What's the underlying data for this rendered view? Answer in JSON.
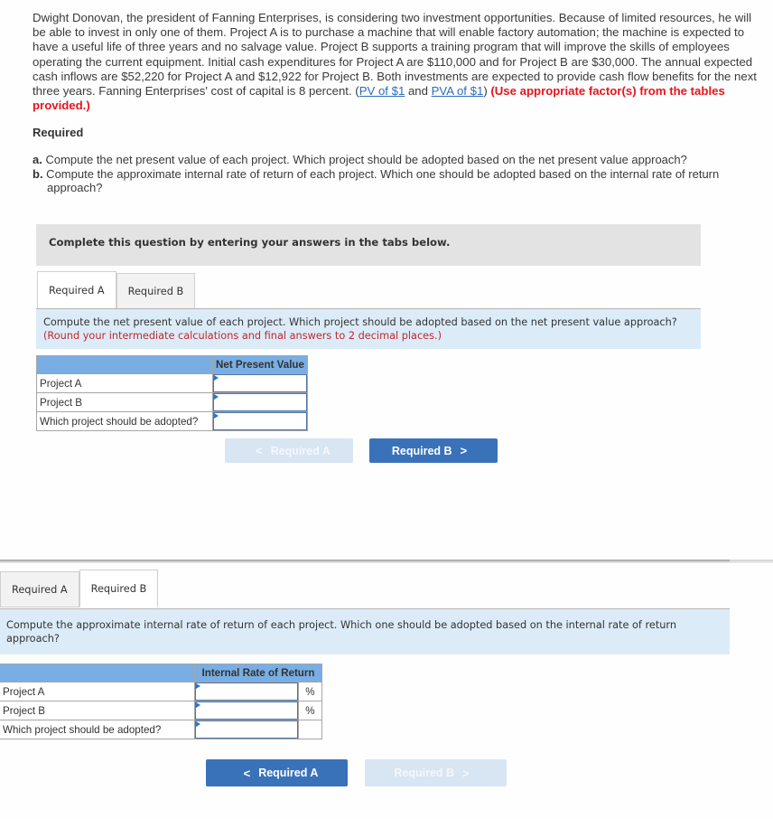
{
  "problem": {
    "text_main": "Dwight Donovan, the president of Fanning Enterprises, is considering two investment opportunities. Because of limited resources, he will be able to invest in only one of them. Project A is to purchase a machine that will enable factory automation; the machine is expected to have a useful life of three years and no salvage value. Project B supports a training program that will improve the skills of employees operating the current equipment. Initial cash expenditures for Project A are $110,000 and for Project B are $30,000. The annual expected cash inflows are $52,220 for Project A and $12,922 for Project B. Both investments are expected to provide cash flow benefits for the next three years. Fanning Enterprises' cost of capital is 8 percent. (",
    "link_pv": "PV of $1",
    "text_and": " and ",
    "link_pva": "PVA of $1",
    "text_close": ") ",
    "instruction_red": "(Use appropriate factor(s) from the tables provided.)"
  },
  "required": {
    "title": "Required",
    "items": [
      {
        "letter": "a.",
        "text": " Compute the net present value of each project. Which project should be adopted based on the net present value approach?"
      },
      {
        "letter": "b.",
        "text": " Compute the approximate internal rate of return of each project. Which one should be adopted based on the internal rate of return approach?"
      }
    ]
  },
  "complete_prompt": "Complete this question by entering your answers in the tabs below.",
  "panel_a": {
    "tabs": [
      {
        "label": "Required A",
        "active": true
      },
      {
        "label": "Required B",
        "active": false
      }
    ],
    "instruction": "Compute the net present value of each project. Which project should be adopted based on the net present value approach?",
    "instruction_red": "(Round your intermediate calculations and final answers to 2 decimal places.)",
    "column_header": "Net Present Value",
    "rows": [
      {
        "label": "Project A",
        "value": ""
      },
      {
        "label": "Project B",
        "value": ""
      },
      {
        "label": "Which project should be adopted?",
        "value": ""
      }
    ],
    "prev_button": {
      "label": "Required A",
      "icon": "chevron-left-icon",
      "enabled": false
    },
    "next_button": {
      "label": "Required B",
      "icon": "chevron-right-icon",
      "enabled": true
    }
  },
  "panel_b": {
    "tabs": [
      {
        "label": "Required A",
        "active": false
      },
      {
        "label": "Required B",
        "active": true
      }
    ],
    "instruction": "Compute the approximate internal rate of return of each project. Which one should be adopted based on the internal rate of return approach?",
    "column_header": "Internal Rate of Return",
    "rows": [
      {
        "label": "Project A",
        "value": "",
        "unit": "%"
      },
      {
        "label": "Project B",
        "value": "",
        "unit": "%"
      },
      {
        "label": "Which project should be adopted?",
        "value": "",
        "unit": ""
      }
    ],
    "prev_button": {
      "label": "Required A",
      "icon": "chevron-left-icon",
      "enabled": true
    },
    "next_button": {
      "label": "Required B",
      "icon": "chevron-right-icon",
      "enabled": false
    }
  },
  "glyphs": {
    "chevron_left": "<",
    "chevron_right": ">"
  },
  "colors": {
    "accent": "#3a72b9",
    "table_header": "#78aee3",
    "instruction_bg": "#dcebf8",
    "warning_red": "#e8141b"
  }
}
